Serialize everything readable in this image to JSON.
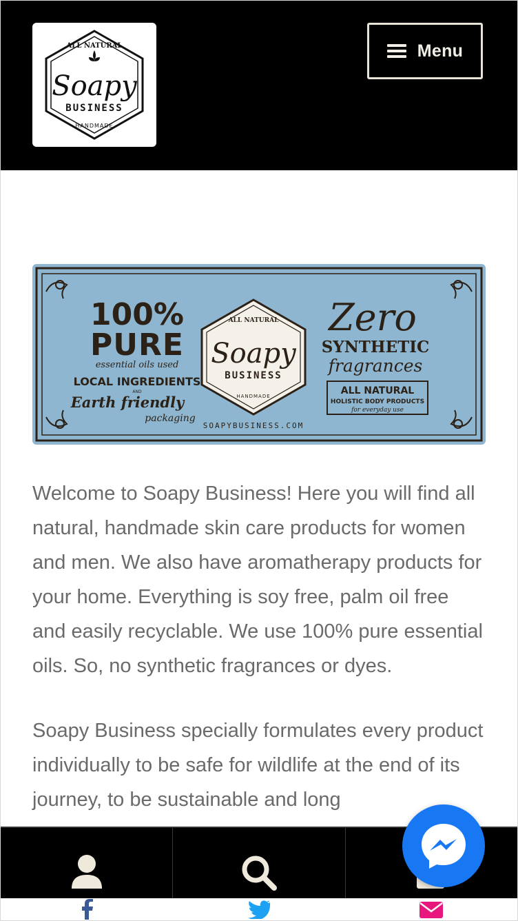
{
  "header": {
    "logo": {
      "top_text": "ALL NATURAL",
      "script_text": "Soapy",
      "word_text": "BUSINESS",
      "bottom_text": "HANDMADE"
    },
    "menu_label": "Menu"
  },
  "banner": {
    "left_big": "100%",
    "left_pure": "PURE",
    "left_line1": "essential oils used",
    "left_line2": "LOCAL INGREDIENTS",
    "left_and": "AND",
    "left_line3": "Earth friendly",
    "left_line4": "packaging",
    "center_top": "ALL NATURAL",
    "center_script": "Soapy",
    "center_word": "BUSINESS",
    "center_bottom": "HANDMADE",
    "url": "SOAPYBUSINESS.COM",
    "right_zero": "Zero",
    "right_synthetic": "SYNTHETIC",
    "right_fragrances": "fragrances",
    "right_box1": "ALL NATURAL",
    "right_box2": "HOLISTIC BODY PRODUCTS",
    "right_box3": "for everyday use"
  },
  "content": {
    "paragraph1": "Welcome to Soapy Business! Here you will find all natural, handmade skin care products for women and men. We also have aromatherapy products for your home. Everything is soy free, palm oil free and easily recyclable. We use 100% pure essential oils. So, no synthetic fragrances or dyes.",
    "paragraph2": "Soapy Business specially formulates every product individually to be safe for wildlife at the end of its journey, to be sustainable and long"
  },
  "bottom_nav": {
    "items": [
      "account-icon",
      "search-icon",
      "cart-icon"
    ]
  },
  "share_bar": {
    "items": [
      "facebook-icon",
      "twitter-icon",
      "email-icon"
    ],
    "colors": {
      "facebook": "#3b5998",
      "twitter": "#1da1f2",
      "email": "#e8177d"
    }
  },
  "colors": {
    "header_bg": "#000000",
    "menu_border": "#e8e3d6",
    "body_text": "#6a6a6a",
    "banner_bg": "#8fb6d0",
    "messenger": "#1877f2"
  }
}
